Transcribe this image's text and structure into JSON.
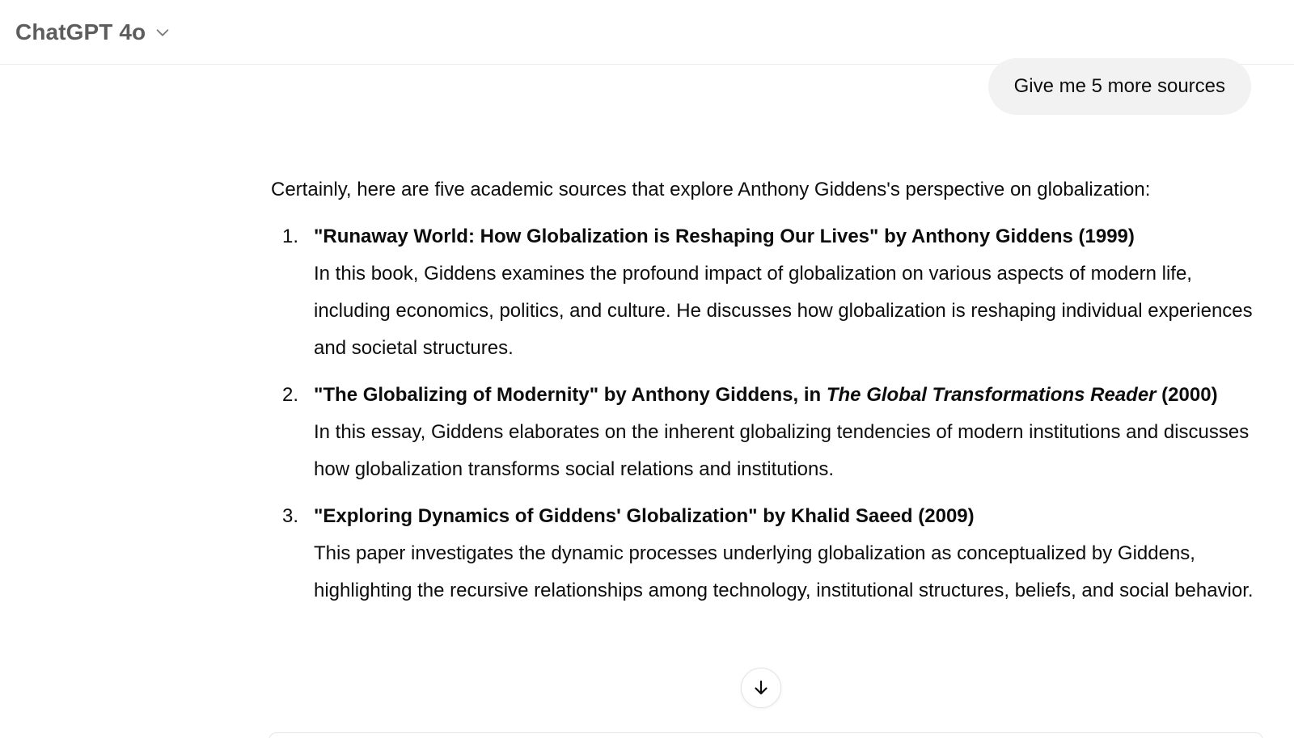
{
  "header": {
    "model_name": "ChatGPT 4o",
    "icons": {
      "model_dropdown": "chevron-down-icon"
    }
  },
  "user_message": {
    "text": "Give me 5 more sources"
  },
  "assistant_message": {
    "intro": "Certainly, here are five academic sources that explore Anthony Giddens's perspective on globalization:",
    "sources": [
      {
        "number": "1.",
        "title": "\"Runaway World: How Globalization is Reshaping Our Lives\" by Anthony Giddens (1999)",
        "description": "In this book, Giddens examines the profound impact of globalization on various aspects of modern life, including economics, politics, and culture. He discusses how globalization is reshaping individual experiences and societal structures."
      },
      {
        "number": "2.",
        "title_prefix": "\"The Globalizing of Modernity\" by Anthony Giddens, in ",
        "title_italic": "The Global Transformations Reader",
        "title_suffix": " (2000)",
        "description": "In this essay, Giddens elaborates on the inherent globalizing tendencies of modern institutions and discusses how globalization transforms social relations and institutions."
      },
      {
        "number": "3.",
        "title": "\"Exploring Dynamics of Giddens' Globalization\" by Khalid Saeed (2009)",
        "description": "This paper investigates the dynamic processes underlying globalization as conceptualized by Giddens, highlighting the recursive relationships among technology, institutional structures, beliefs, and social behavior."
      }
    ]
  },
  "scroll_button": {
    "icon": "arrow-down-icon"
  }
}
